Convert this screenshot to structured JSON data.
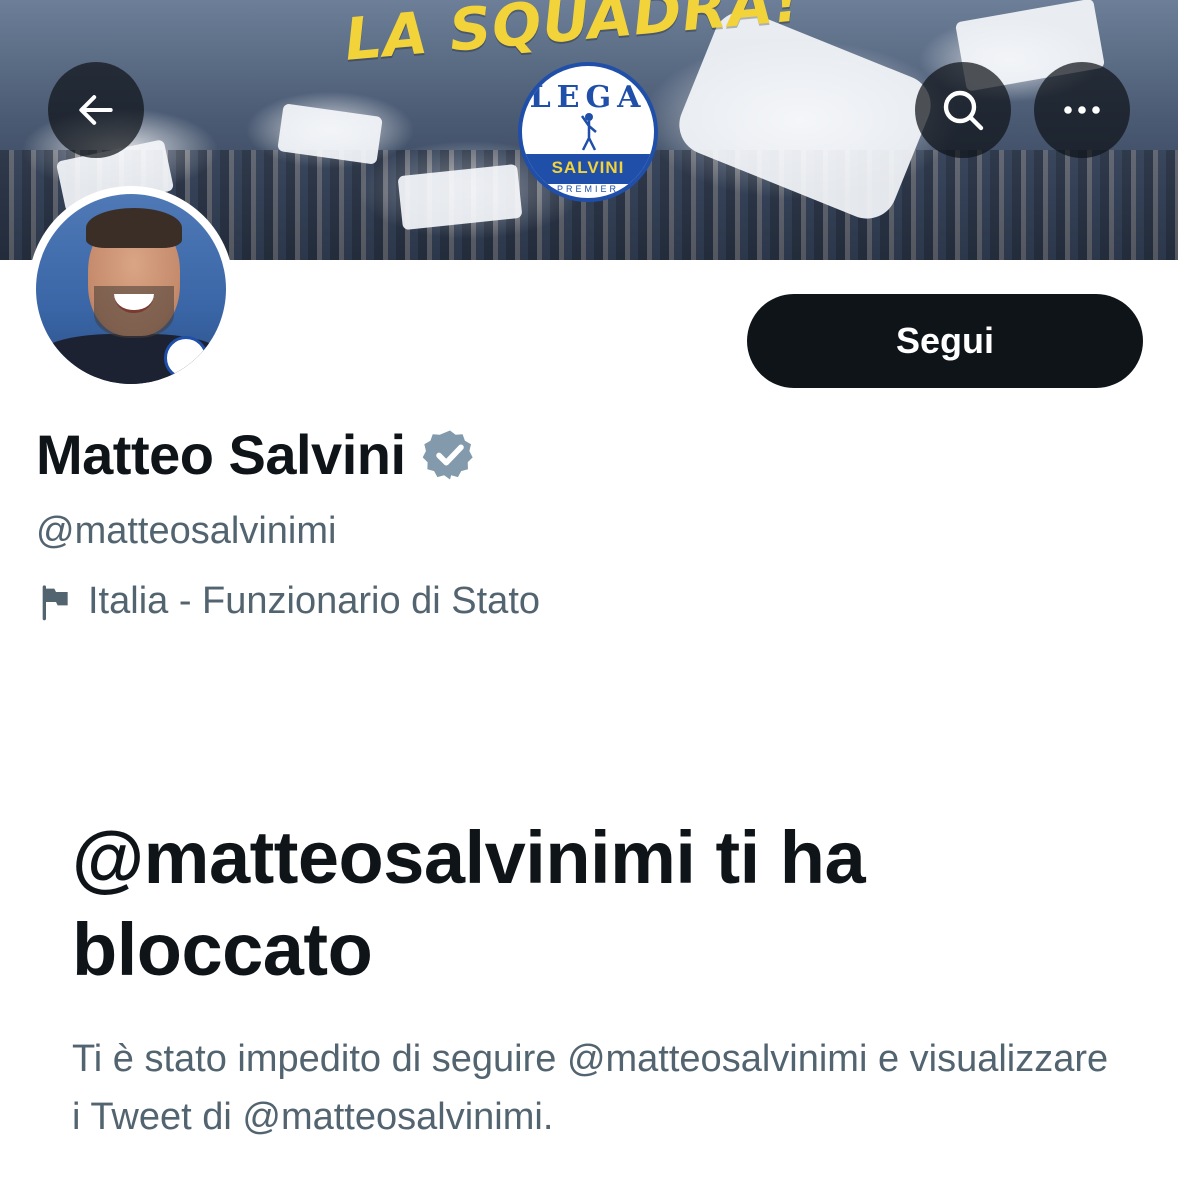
{
  "banner": {
    "headline": "LA SQUADRA!",
    "logo": {
      "top_text": "LEGA",
      "band_text": "SALVINI",
      "bottom_text": "PREMIER"
    }
  },
  "nav": {
    "back_icon": "arrow-left-icon",
    "search_icon": "search-icon",
    "more_icon": "more-horizontal-icon"
  },
  "profile": {
    "display_name": "Matteo Salvini",
    "verified": true,
    "handle": "@matteosalvinimi",
    "bio": "Italia - Funzionario di Stato",
    "bio_icon": "flag-icon"
  },
  "follow_button": {
    "label": "Segui"
  },
  "blocked": {
    "title": "@matteosalvinimi ti ha bloccato",
    "description": "Ti è stato impedito di seguire @matteosalvinimi e visualizzare i Tweet di @matteosalvinimi."
  },
  "colors": {
    "text_primary": "#0f1419",
    "text_secondary": "#536471",
    "button_bg": "#0f1419",
    "headline_yellow": "#f2d43a",
    "logo_blue": "#1f4fa8",
    "verified_gray": "#829aab"
  }
}
